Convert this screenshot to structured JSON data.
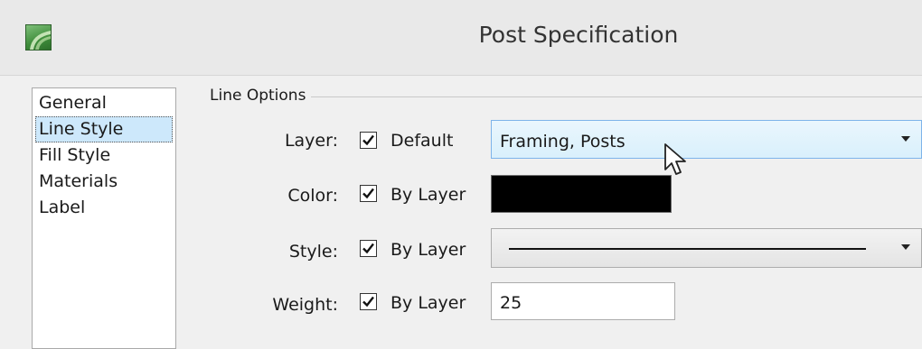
{
  "window": {
    "title": "Post Specification"
  },
  "sidebar": {
    "items": [
      {
        "label": "General"
      },
      {
        "label": "Line Style",
        "selected": true
      },
      {
        "label": "Fill Style"
      },
      {
        "label": "Materials"
      },
      {
        "label": "Label"
      }
    ]
  },
  "line_options": {
    "group_label": "Line Options",
    "layer": {
      "label": "Layer:",
      "checkbox_label": "Default",
      "checked": true,
      "value": "Framing, Posts"
    },
    "color": {
      "label": "Color:",
      "checkbox_label": "By Layer",
      "checked": true,
      "swatch_color": "#000000"
    },
    "style": {
      "label": "Style:",
      "checkbox_label": "By Layer",
      "checked": true
    },
    "weight": {
      "label": "Weight:",
      "checkbox_label": "By Layer",
      "checked": true,
      "value": "25"
    }
  },
  "icons": {
    "app": "app-logo-icon",
    "check": "checkmark-icon",
    "dropdown": "chevron-down-icon",
    "pointer": "mouse-pointer-icon"
  }
}
